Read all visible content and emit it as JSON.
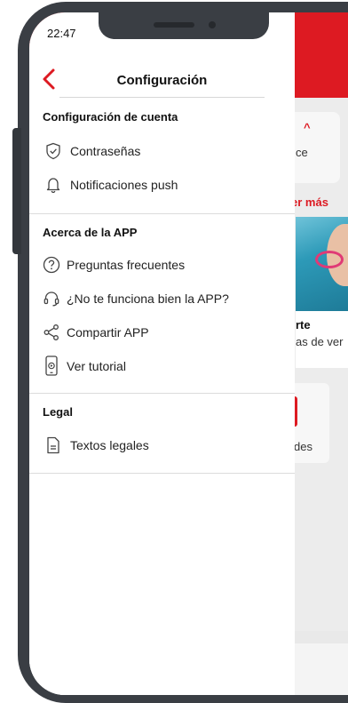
{
  "status_bar": {
    "time": "22:47"
  },
  "header": {
    "title": "Configuración"
  },
  "sections": [
    {
      "title": "Configuración de cuenta",
      "items": [
        {
          "label": "Contraseñas",
          "icon": "shield-check-icon"
        },
        {
          "label": "Notificaciones push",
          "icon": "bell-icon"
        }
      ]
    },
    {
      "title": "Acerca de la APP",
      "items": [
        {
          "label": "Preguntas frecuentes",
          "icon": "question-icon"
        },
        {
          "label": "¿No te funciona bien la APP?",
          "icon": "headset-icon"
        },
        {
          "label": "Compartir APP",
          "icon": "share-icon"
        },
        {
          "label": "Ver tutorial",
          "icon": "phone-play-icon"
        }
      ]
    },
    {
      "title": "Legal",
      "items": [
        {
          "label": "Textos legales",
          "icon": "document-icon"
        }
      ]
    }
  ],
  "background_app": {
    "link_text": "er más",
    "fragment_ce": "ce",
    "card_title": "rte",
    "card_subtitle": "as de ver",
    "fragment_des": "des",
    "accent_color": "#dd1a22"
  }
}
